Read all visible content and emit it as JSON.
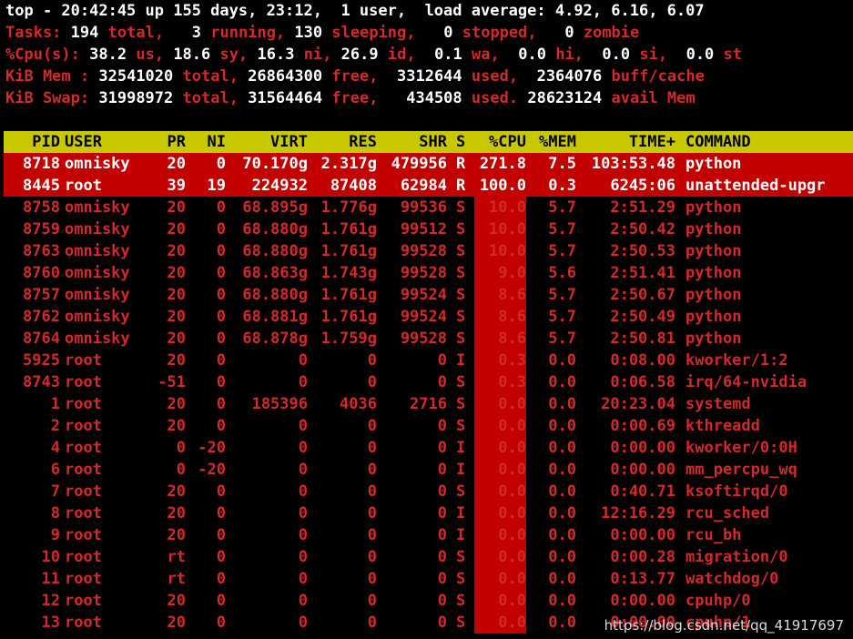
{
  "summary": {
    "line1": "top - 20:42:45 up 155 days, 23:12,  1 user,  load average: 4.92, 6.16, 6.07",
    "tasks": {
      "label": "Tasks:",
      "total": "194",
      "total_l": "total,",
      "running": "3",
      "running_l": "running,",
      "sleeping": "130",
      "sleeping_l": "sleeping,",
      "stopped": "0",
      "stopped_l": "stopped,",
      "zombie": "0",
      "zombie_l": "zombie"
    },
    "cpu": {
      "label": "%Cpu(s):",
      "us": "38.2",
      "us_l": "us,",
      "sy": "18.6",
      "sy_l": "sy,",
      "ni": "16.3",
      "ni_l": "ni,",
      "id": "26.9",
      "id_l": "id,",
      "wa": "0.1",
      "wa_l": "wa,",
      "hi": "0.0",
      "hi_l": "hi,",
      "si": "0.0",
      "si_l": "si,",
      "st": "0.0",
      "st_l": "st"
    },
    "mem": {
      "label": "KiB Mem :",
      "total": "32541020",
      "total_l": "total,",
      "free": "26864300",
      "free_l": "free,",
      "used": "3312644",
      "used_l": "used,",
      "buff": "2364076",
      "buff_l": "buff/cache"
    },
    "swap": {
      "label": "KiB Swap:",
      "total": "31998972",
      "total_l": "total,",
      "free": "31564464",
      "free_l": "free,",
      "used": "434508",
      "used_l": "used.",
      "avail": "28623124",
      "avail_l": "avail Mem"
    }
  },
  "header": [
    "PID",
    "USER",
    "PR",
    "NI",
    "VIRT",
    "RES",
    "SHR",
    "S",
    "%CPU",
    "%MEM",
    "TIME+",
    "COMMAND"
  ],
  "processes": [
    {
      "pid": "8718",
      "user": "omnisky",
      "pr": "20",
      "ni": "0",
      "virt": "70.170g",
      "res": "2.317g",
      "shr": "479956",
      "s": "R",
      "cpu": "271.8",
      "mem": "7.5",
      "time": "103:53.48",
      "cmd": "python"
    },
    {
      "pid": "8445",
      "user": "root",
      "pr": "39",
      "ni": "19",
      "virt": "224932",
      "res": "87408",
      "shr": "62984",
      "s": "R",
      "cpu": "100.0",
      "mem": "0.3",
      "time": "6245:06",
      "cmd": "unattended-upgr"
    },
    {
      "pid": "8758",
      "user": "omnisky",
      "pr": "20",
      "ni": "0",
      "virt": "68.895g",
      "res": "1.776g",
      "shr": "99536",
      "s": "S",
      "cpu": "10.0",
      "mem": "5.7",
      "time": "2:51.29",
      "cmd": "python"
    },
    {
      "pid": "8759",
      "user": "omnisky",
      "pr": "20",
      "ni": "0",
      "virt": "68.880g",
      "res": "1.761g",
      "shr": "99512",
      "s": "S",
      "cpu": "10.0",
      "mem": "5.7",
      "time": "2:50.42",
      "cmd": "python"
    },
    {
      "pid": "8763",
      "user": "omnisky",
      "pr": "20",
      "ni": "0",
      "virt": "68.880g",
      "res": "1.761g",
      "shr": "99528",
      "s": "S",
      "cpu": "10.0",
      "mem": "5.7",
      "time": "2:50.53",
      "cmd": "python"
    },
    {
      "pid": "8760",
      "user": "omnisky",
      "pr": "20",
      "ni": "0",
      "virt": "68.863g",
      "res": "1.743g",
      "shr": "99528",
      "s": "S",
      "cpu": "9.0",
      "mem": "5.6",
      "time": "2:51.41",
      "cmd": "python"
    },
    {
      "pid": "8757",
      "user": "omnisky",
      "pr": "20",
      "ni": "0",
      "virt": "68.880g",
      "res": "1.761g",
      "shr": "99524",
      "s": "S",
      "cpu": "8.6",
      "mem": "5.7",
      "time": "2:50.67",
      "cmd": "python"
    },
    {
      "pid": "8762",
      "user": "omnisky",
      "pr": "20",
      "ni": "0",
      "virt": "68.881g",
      "res": "1.761g",
      "shr": "99524",
      "s": "S",
      "cpu": "8.6",
      "mem": "5.7",
      "time": "2:50.49",
      "cmd": "python"
    },
    {
      "pid": "8764",
      "user": "omnisky",
      "pr": "20",
      "ni": "0",
      "virt": "68.878g",
      "res": "1.759g",
      "shr": "99528",
      "s": "S",
      "cpu": "8.6",
      "mem": "5.7",
      "time": "2:50.81",
      "cmd": "python"
    },
    {
      "pid": "5925",
      "user": "root",
      "pr": "20",
      "ni": "0",
      "virt": "0",
      "res": "0",
      "shr": "0",
      "s": "I",
      "cpu": "0.3",
      "mem": "0.0",
      "time": "0:08.00",
      "cmd": "kworker/1:2"
    },
    {
      "pid": "8743",
      "user": "root",
      "pr": "-51",
      "ni": "0",
      "virt": "0",
      "res": "0",
      "shr": "0",
      "s": "S",
      "cpu": "0.3",
      "mem": "0.0",
      "time": "0:06.58",
      "cmd": "irq/64-nvidia"
    },
    {
      "pid": "1",
      "user": "root",
      "pr": "20",
      "ni": "0",
      "virt": "185396",
      "res": "4036",
      "shr": "2716",
      "s": "S",
      "cpu": "0.0",
      "mem": "0.0",
      "time": "20:23.04",
      "cmd": "systemd"
    },
    {
      "pid": "2",
      "user": "root",
      "pr": "20",
      "ni": "0",
      "virt": "0",
      "res": "0",
      "shr": "0",
      "s": "S",
      "cpu": "0.0",
      "mem": "0.0",
      "time": "0:00.69",
      "cmd": "kthreadd"
    },
    {
      "pid": "4",
      "user": "root",
      "pr": "0",
      "ni": "-20",
      "virt": "0",
      "res": "0",
      "shr": "0",
      "s": "I",
      "cpu": "0.0",
      "mem": "0.0",
      "time": "0:00.00",
      "cmd": "kworker/0:0H"
    },
    {
      "pid": "6",
      "user": "root",
      "pr": "0",
      "ni": "-20",
      "virt": "0",
      "res": "0",
      "shr": "0",
      "s": "I",
      "cpu": "0.0",
      "mem": "0.0",
      "time": "0:00.00",
      "cmd": "mm_percpu_wq"
    },
    {
      "pid": "7",
      "user": "root",
      "pr": "20",
      "ni": "0",
      "virt": "0",
      "res": "0",
      "shr": "0",
      "s": "S",
      "cpu": "0.0",
      "mem": "0.0",
      "time": "0:40.71",
      "cmd": "ksoftirqd/0"
    },
    {
      "pid": "8",
      "user": "root",
      "pr": "20",
      "ni": "0",
      "virt": "0",
      "res": "0",
      "shr": "0",
      "s": "I",
      "cpu": "0.0",
      "mem": "0.0",
      "time": "12:16.29",
      "cmd": "rcu_sched"
    },
    {
      "pid": "9",
      "user": "root",
      "pr": "20",
      "ni": "0",
      "virt": "0",
      "res": "0",
      "shr": "0",
      "s": "I",
      "cpu": "0.0",
      "mem": "0.0",
      "time": "0:00.00",
      "cmd": "rcu_bh"
    },
    {
      "pid": "10",
      "user": "root",
      "pr": "rt",
      "ni": "0",
      "virt": "0",
      "res": "0",
      "shr": "0",
      "s": "S",
      "cpu": "0.0",
      "mem": "0.0",
      "time": "0:00.28",
      "cmd": "migration/0"
    },
    {
      "pid": "11",
      "user": "root",
      "pr": "rt",
      "ni": "0",
      "virt": "0",
      "res": "0",
      "shr": "0",
      "s": "S",
      "cpu": "0.0",
      "mem": "0.0",
      "time": "0:13.77",
      "cmd": "watchdog/0"
    },
    {
      "pid": "12",
      "user": "root",
      "pr": "20",
      "ni": "0",
      "virt": "0",
      "res": "0",
      "shr": "0",
      "s": "S",
      "cpu": "0.0",
      "mem": "0.0",
      "time": "0:00.00",
      "cmd": "cpuhp/0"
    },
    {
      "pid": "13",
      "user": "root",
      "pr": "20",
      "ni": "0",
      "virt": "0",
      "res": "0",
      "shr": "0",
      "s": "S",
      "cpu": "0.0",
      "mem": "0.0",
      "time": "0:00.00",
      "cmd": "cpuhp/1"
    }
  ],
  "watermark": "https://blog.csdn.net/qq_41917697",
  "colors": {
    "bg": "#000000",
    "label": "#d12a2a",
    "value": "#ffffff",
    "header_bg": "#c8c800",
    "highlight": "#c20000"
  }
}
